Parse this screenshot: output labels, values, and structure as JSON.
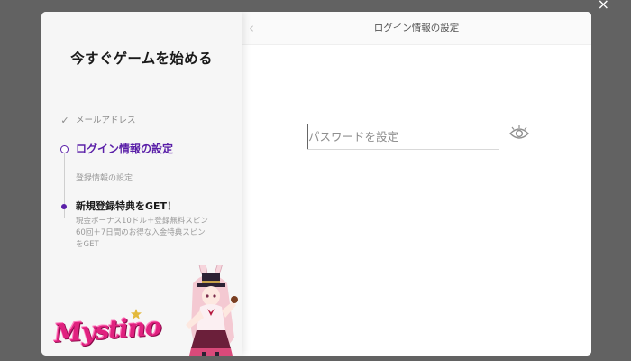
{
  "close_label": "×",
  "left_panel": {
    "title": "今すぐゲームを始める",
    "steps": [
      {
        "marker": "✓",
        "label": "メールアドレス",
        "state": "done"
      },
      {
        "label": "ログイン情報の設定",
        "state": "active"
      },
      {
        "label": "登録情報の設定",
        "state": "pending"
      },
      {
        "label": "新規登録特典をGET！",
        "state": "highlight"
      }
    ],
    "bonus_description": [
      "現金ボーナス10ドル＋登録無料スピン",
      "60回＋7日間のお得な入金特典スピン",
      "をGET"
    ],
    "brand_name": "Mystino"
  },
  "right_panel": {
    "back_icon": "‹",
    "title": "ログイン情報の設定",
    "password_field": {
      "placeholder": "パスワードを設定",
      "value": ""
    },
    "toggle_visibility_icon": "eye-icon"
  },
  "colors": {
    "accent": "#5a1fa8",
    "brand": "#e0217f",
    "overlay": "#626262"
  }
}
